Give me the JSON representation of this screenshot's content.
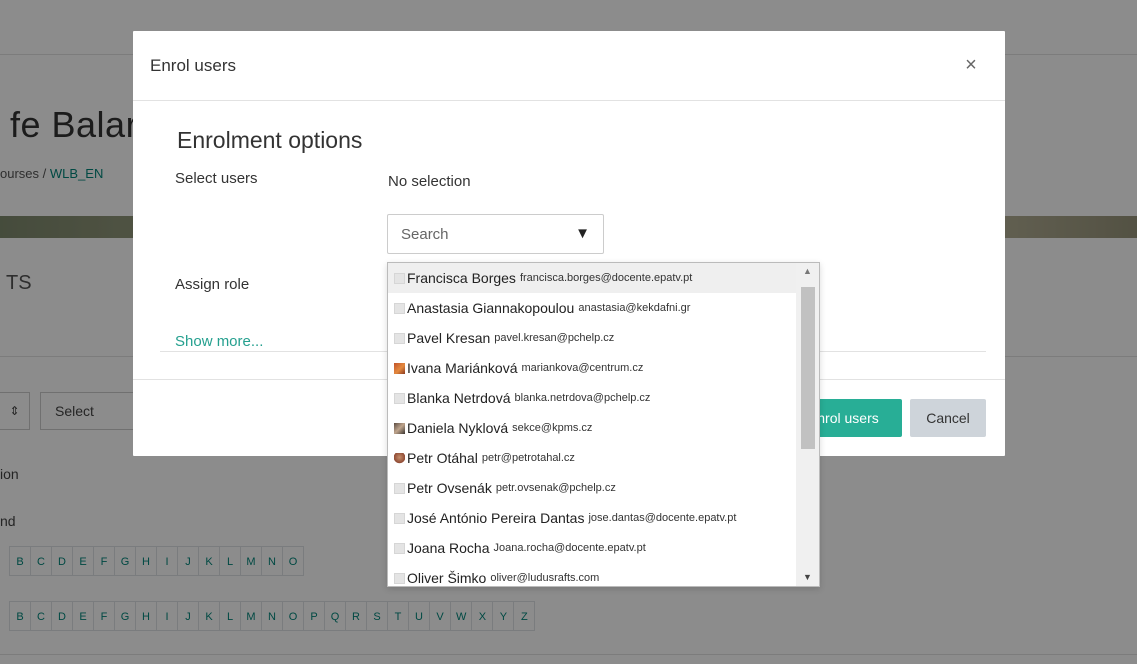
{
  "background": {
    "course_title": "fe Balar",
    "breadcrumb": {
      "parent": "ourses",
      "separator": "/",
      "current": "WLB_EN"
    },
    "section_title": "TS",
    "sort_symbol": "⇕",
    "bulk_select_label": "Select",
    "filter_label_1": "ion",
    "filter_label_2": "nd",
    "letters_row_1": [
      "B",
      "C",
      "D",
      "E",
      "F",
      "G",
      "H",
      "I",
      "J",
      "K",
      "L",
      "M",
      "N",
      "O"
    ],
    "letters_row_2": [
      "B",
      "C",
      "D",
      "E",
      "F",
      "G",
      "H",
      "I",
      "J",
      "K",
      "L",
      "M",
      "N",
      "O",
      "P",
      "Q",
      "R",
      "S",
      "T",
      "U",
      "V",
      "W",
      "X",
      "Y",
      "Z"
    ]
  },
  "modal": {
    "title": "Enrol users",
    "close_symbol": "×",
    "section_title": "Enrolment options",
    "select_users_label": "Select users",
    "selection_status": "No selection",
    "search_placeholder": "Search",
    "search_arrow": "▼",
    "assign_role_label": "Assign role",
    "show_more_label": "Show more...",
    "enrol_button_label": "nrol users",
    "cancel_button_label": "Cancel"
  },
  "user_dropdown": {
    "options": [
      {
        "name": "Francisca Borges",
        "email": "francisca.borges@docente.epatv.pt",
        "avatar": "default",
        "selected": true
      },
      {
        "name": "Anastasia Giannakopoulou",
        "email": "anastasia@kekdafni.gr",
        "avatar": "default",
        "selected": false
      },
      {
        "name": "Pavel Kresan",
        "email": "pavel.kresan@pchelp.cz",
        "avatar": "default",
        "selected": false
      },
      {
        "name": "Ivana Mariánková",
        "email": "mariankova@centrum.cz",
        "avatar": "photo-1",
        "selected": false
      },
      {
        "name": "Blanka Netrdová",
        "email": "blanka.netrdova@pchelp.cz",
        "avatar": "default",
        "selected": false
      },
      {
        "name": "Daniela Nyklová",
        "email": "sekce@kpms.cz",
        "avatar": "photo-2",
        "selected": false
      },
      {
        "name": "Petr Otáhal",
        "email": "petr@petrotahal.cz",
        "avatar": "photo-3",
        "selected": false
      },
      {
        "name": "Petr Ovsenák",
        "email": "petr.ovsenak@pchelp.cz",
        "avatar": "default",
        "selected": false
      },
      {
        "name": "José António Pereira Dantas",
        "email": "jose.dantas@docente.epatv.pt",
        "avatar": "default",
        "selected": false
      },
      {
        "name": "Joana Rocha",
        "email": "Joana.rocha@docente.epatv.pt",
        "avatar": "default",
        "selected": false
      },
      {
        "name": "Oliver Šimko",
        "email": "oliver@ludusrafts.com",
        "avatar": "default",
        "selected": false
      }
    ],
    "scroll_up_symbol": "▲",
    "scroll_down_symbol": "▼"
  },
  "colors": {
    "accent": "#28ae96",
    "link": "#25a08f",
    "cancel_bg": "#ced4da"
  }
}
